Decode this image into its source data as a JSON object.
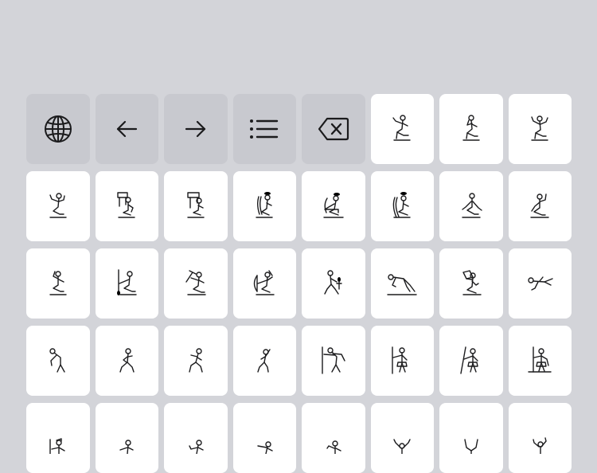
{
  "keyboard": {
    "function_keys": [
      {
        "icon": "globe-icon"
      },
      {
        "icon": "arrow-left-icon"
      },
      {
        "icon": "arrow-right-icon"
      },
      {
        "icon": "list-icon"
      },
      {
        "icon": "backspace-icon"
      }
    ],
    "glyph_keys": [
      {
        "glyph": "seated-man-arm-raised"
      },
      {
        "glyph": "seated-man-hand-to-mouth"
      },
      {
        "glyph": "seated-man-arms-raised"
      },
      {
        "glyph": "kneeling-man-arms-raised"
      },
      {
        "glyph": "man-with-frame-on-head"
      },
      {
        "glyph": "man-with-frame-on-head-2"
      },
      {
        "glyph": "man-with-basket-on-head"
      },
      {
        "glyph": "man-with-basket-kneading"
      },
      {
        "glyph": "man-with-basket-on-back"
      },
      {
        "glyph": "kneeling-man-arms-out"
      },
      {
        "glyph": "kneeling-man-arm-up"
      },
      {
        "glyph": "kneeling-man-hand-to-head"
      },
      {
        "glyph": "seated-man-with-staff"
      },
      {
        "glyph": "seated-man-with-mace"
      },
      {
        "glyph": "seated-man-with-bow"
      },
      {
        "glyph": "kneeling-man-with-ankh"
      },
      {
        "glyph": "crawling-man"
      },
      {
        "glyph": "kneeling-man-with-jar"
      },
      {
        "glyph": "falling-man"
      },
      {
        "glyph": "bending-man"
      },
      {
        "glyph": "running-man"
      },
      {
        "glyph": "walking-man-bent"
      },
      {
        "glyph": "dancing-man"
      },
      {
        "glyph": "man-with-stick-striking"
      },
      {
        "glyph": "man-with-staff"
      },
      {
        "glyph": "man-with-staff-2"
      },
      {
        "glyph": "man-with-staff-and-mace"
      },
      {
        "glyph": "man-with-staff-partial"
      },
      {
        "glyph": "man-pointing-partial"
      },
      {
        "glyph": "man-reaching-partial"
      },
      {
        "glyph": "man-bowing-partial"
      },
      {
        "glyph": "man-arms-out-partial"
      },
      {
        "glyph": "man-arms-raised-partial"
      },
      {
        "glyph": "man-arms-up-partial"
      },
      {
        "glyph": "man-adoring-partial"
      }
    ]
  }
}
